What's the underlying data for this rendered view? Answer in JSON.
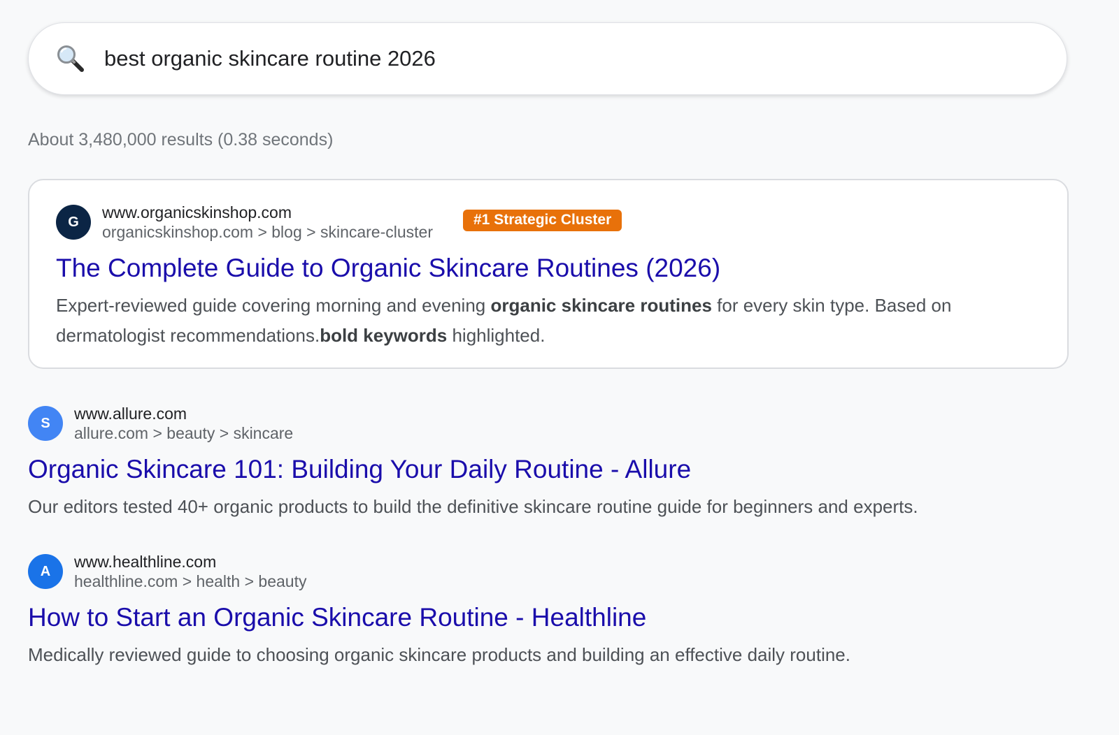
{
  "search": {
    "query": "best organic skincare routine 2026",
    "icon": "magnifying-glass-icon"
  },
  "stats": {
    "text": "About 3,480,000 results (0.38 seconds)"
  },
  "results": [
    {
      "favicon_letter": "G",
      "favicon_color": "#0b2545",
      "domain": "www.organicskinshop.com",
      "breadcrumb": "organicskinshop.com > blog > skincare-cluster",
      "badge": "#1 Strategic Cluster",
      "badge_color": "#e8710a",
      "title": "The Complete Guide to Organic Skincare Routines (2026)",
      "snippet_1": "Expert-reviewed guide covering morning and evening ",
      "snippet_bold_1": "organic skincare routines",
      "snippet_2": " for every skin type. Based on dermatologist recommendations.",
      "snippet_bold_2": "bold keywords",
      "snippet_3": " highlighted."
    },
    {
      "favicon_letter": "S",
      "favicon_color": "#4285f4",
      "domain": "www.allure.com",
      "breadcrumb": "allure.com > beauty > skincare",
      "title": "Organic Skincare 101: Building Your Daily Routine - Allure",
      "snippet": "Our editors tested 40+ organic products to build the definitive skincare routine guide for beginners and experts."
    },
    {
      "favicon_letter": "A",
      "favicon_color": "#1a73e8",
      "domain": "www.healthline.com",
      "breadcrumb": "healthline.com > health > beauty",
      "title": "How to Start an Organic Skincare Routine - Healthline",
      "snippet": "Medically reviewed guide to choosing organic skincare products and building an effective daily routine."
    }
  ]
}
